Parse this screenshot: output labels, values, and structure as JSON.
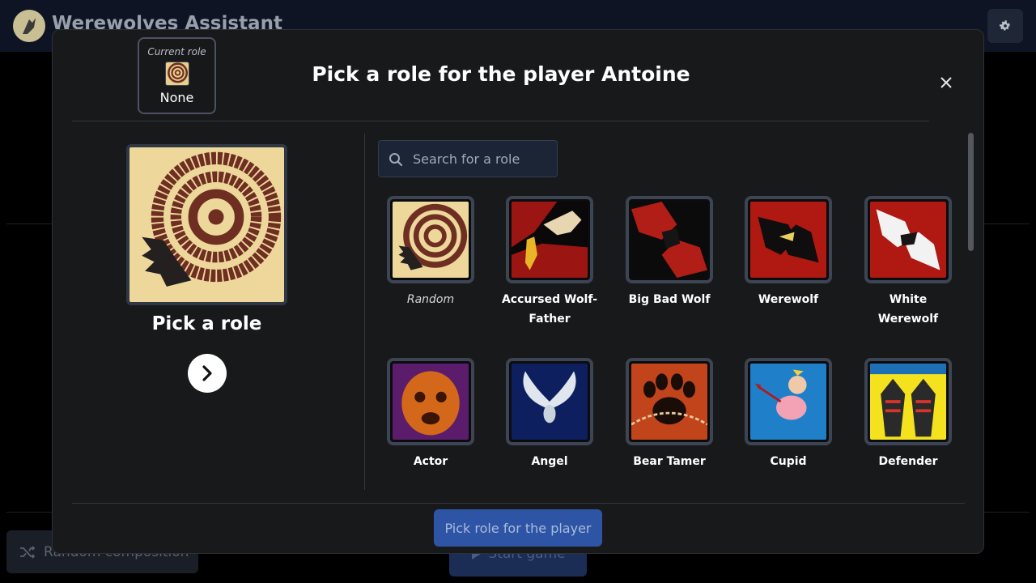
{
  "app": {
    "title": "Werewolves Assistant",
    "logo_icon": "werewolf-logo-icon",
    "settings_icon": "gear-icon"
  },
  "background": {
    "random_composition_label": "Random composition",
    "start_game_label": "Start game"
  },
  "modal": {
    "current_role": {
      "label": "Current role",
      "value": "None",
      "icon": "spiral-icon"
    },
    "title": "Pick a role for the player Antoine",
    "close_icon": "close-icon",
    "selected": {
      "name": "Pick a role",
      "image": "random-spiral"
    },
    "next_icon": "chevron-right-icon",
    "search": {
      "placeholder": "Search for a role",
      "value": ""
    },
    "roles": [
      {
        "name": "Random",
        "italic": true,
        "image": "spiral"
      },
      {
        "name": "Accursed Wolf-Father",
        "image": "wolf-father"
      },
      {
        "name": "Big Bad Wolf",
        "image": "big-bad-wolf"
      },
      {
        "name": "Werewolf",
        "image": "werewolf"
      },
      {
        "name": "White Werewolf",
        "image": "white-werewolf"
      },
      {
        "name": "Actor",
        "image": "actor-mask"
      },
      {
        "name": "Angel",
        "image": "angel-wings"
      },
      {
        "name": "Bear Tamer",
        "image": "bear-paw"
      },
      {
        "name": "Cupid",
        "image": "cupid"
      },
      {
        "name": "Defender",
        "image": "defender"
      }
    ],
    "pick_button_label": "Pick role for the player"
  },
  "colors": {
    "modal_bg": "#18191b",
    "primary_button": "#2e55a5",
    "card_border": "#3d4554",
    "topbar": "#0e1424"
  }
}
